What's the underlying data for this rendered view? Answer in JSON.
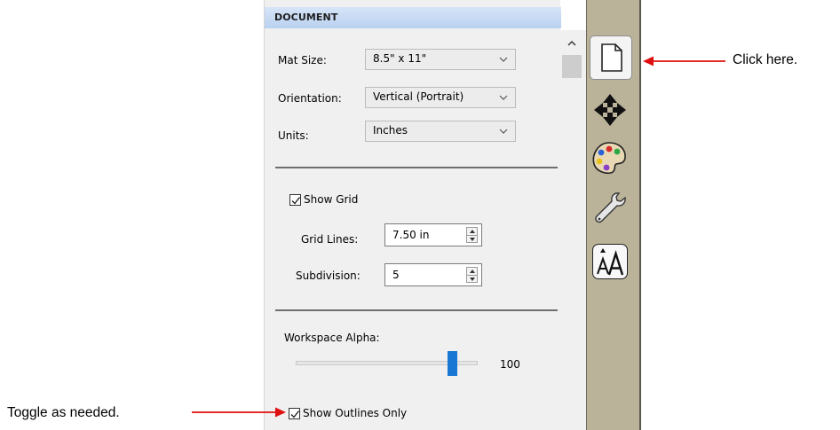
{
  "panel": {
    "header": "DOCUMENT",
    "mat_size": {
      "label": "Mat Size:",
      "value": "8.5\" x 11\""
    },
    "orientation": {
      "label": "Orientation:",
      "value": "Vertical (Portrait)"
    },
    "units": {
      "label": "Units:",
      "value": "Inches"
    },
    "show_grid": {
      "label": "Show Grid",
      "checked": true
    },
    "grid_lines": {
      "label": "Grid Lines:",
      "value": "7.50 in"
    },
    "subdivision": {
      "label": "Subdivision:",
      "value": "5"
    },
    "workspace_alpha": {
      "label": "Workspace Alpha:",
      "value": "100",
      "level_percent": 100
    },
    "show_outlines_only": {
      "label": "Show Outlines Only",
      "checked": true
    }
  },
  "tabs": [
    {
      "name": "document-icon",
      "active": true
    },
    {
      "name": "move-arrows-icon",
      "active": false
    },
    {
      "name": "palette-icon",
      "active": false
    },
    {
      "name": "wrench-icon",
      "active": false
    },
    {
      "name": "text-size-icon",
      "active": false
    }
  ],
  "annotations": {
    "click_here": "Click here.",
    "toggle": "Toggle as needed."
  },
  "colors": {
    "header_gradient_top": "#d6e4f7",
    "header_gradient_bottom": "#b9d1f0",
    "tabstrip": "#bab39a",
    "slider_thumb": "#1a78d4",
    "annotation_arrow": "#e01010"
  }
}
